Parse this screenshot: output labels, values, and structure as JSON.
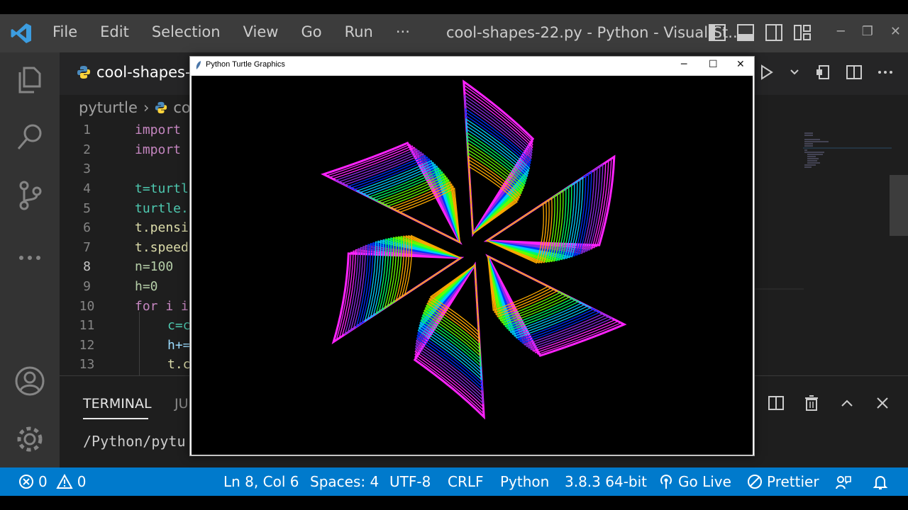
{
  "titlebar": {
    "menu": [
      "File",
      "Edit",
      "Selection",
      "View",
      "Go",
      "Run",
      "···"
    ],
    "title": "cool-shapes-22.py - Python - Visual St..."
  },
  "tab": {
    "label": "cool-shapes-"
  },
  "breadcrumb": {
    "folder": "pyturtle",
    "file": "co"
  },
  "code_lines": [
    {
      "n": "1",
      "text": "import"
    },
    {
      "n": "2",
      "text": "import"
    },
    {
      "n": "3",
      "text": ""
    },
    {
      "n": "4",
      "text": "t=turtl"
    },
    {
      "n": "5",
      "text": "turtle."
    },
    {
      "n": "6",
      "text": "t.pensi"
    },
    {
      "n": "7",
      "text": "t.speed"
    },
    {
      "n": "8",
      "text": "n=100"
    },
    {
      "n": "9",
      "text": "h=0"
    },
    {
      "n": "10",
      "text": "for i i"
    },
    {
      "n": "11",
      "text": "c=c"
    },
    {
      "n": "12",
      "text": "h+="
    },
    {
      "n": "13",
      "text": "t.c"
    }
  ],
  "panel": {
    "tab_terminal": "TERMINAL",
    "tab_other": "JU",
    "terminal_text": "/Python/pytu"
  },
  "turtle_window": {
    "title": "Python Turtle Graphics"
  },
  "status": {
    "errors": "0",
    "warnings": "0",
    "position": "Ln 8, Col 6",
    "spaces": "Spaces: 4",
    "encoding": "UTF-8",
    "eol": "CRLF",
    "language": "Python",
    "interpreter": "3.8.3 64-bit",
    "golive": "Go Live",
    "prettier": "Prettier"
  },
  "colors": {
    "statusbar": "#007acc",
    "titlebar": "#3c3c3c",
    "activity": "#333333",
    "editor": "#1e1e1e"
  },
  "artwork": {
    "arms": 6,
    "palette": [
      "#ff22ff",
      "#8a2be2",
      "#0033ff",
      "#00ccff",
      "#00ff66",
      "#66ff00",
      "#ffaa00"
    ]
  }
}
